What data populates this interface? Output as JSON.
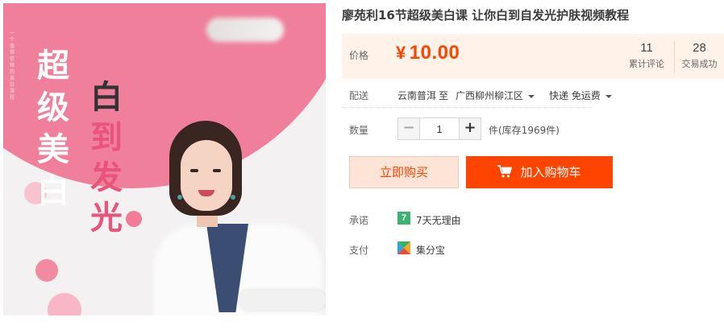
{
  "image": {
    "side_text": "一个值得信赖的美白课程",
    "headline_left": "超级美白",
    "headline_right_first": "白",
    "headline_right_rest": "到发光"
  },
  "product": {
    "title": "廖苑利16节超级美白课 让你白到自发光护肤视频教程"
  },
  "price": {
    "label": "价格",
    "currency": "¥",
    "value": "10.00",
    "color": "#ff4400"
  },
  "stats": {
    "reviews_count": "11",
    "reviews_label": "累计评论",
    "sales_count": "28",
    "sales_label": "交易成功"
  },
  "delivery": {
    "label": "配送",
    "from": "云南普洱",
    "to_word": "至",
    "destination": "广西柳州柳江区",
    "method": "快递 免运费"
  },
  "quantity": {
    "label": "数量",
    "minus": "−",
    "plus": "+",
    "value": "1",
    "stock_text": "件(库存1969件)"
  },
  "actions": {
    "buy_now": "立即购买",
    "add_to_cart": "加入购物车"
  },
  "promise": {
    "label": "承诺",
    "badge": "7",
    "text": "7天无理由"
  },
  "payment": {
    "label": "支付",
    "icon": "jifenbao-icon",
    "text": "集分宝"
  }
}
